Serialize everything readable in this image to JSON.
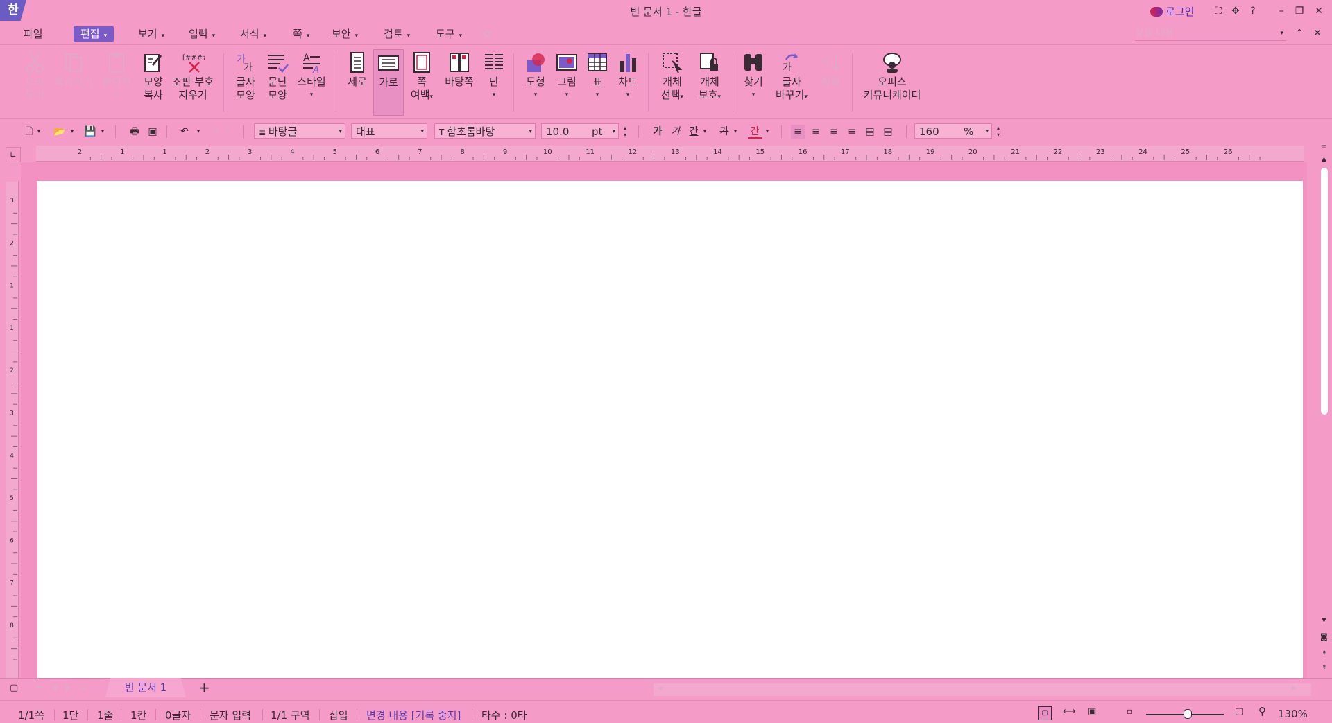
{
  "app": {
    "logo": "한",
    "title": "빈 문서 1 - 한글",
    "login": "로그인"
  },
  "window_controls": {
    "fullscreen": "⛶",
    "move": "✥",
    "help": "?",
    "minimize": "–",
    "restore": "❐",
    "close": "✕"
  },
  "menubar": {
    "items": [
      {
        "label": "파일"
      },
      {
        "label": "편집",
        "active": true
      },
      {
        "label": "보기"
      },
      {
        "label": "입력"
      },
      {
        "label": "서식"
      },
      {
        "label": "쪽"
      },
      {
        "label": "보안"
      },
      {
        "label": "검토"
      },
      {
        "label": "도구"
      }
    ],
    "search_placeholder": "찾을 내용"
  },
  "ribbon": {
    "cut": {
      "line1": "오려",
      "line2": "두기"
    },
    "copy": {
      "label": "복사하기"
    },
    "paste": {
      "label": "붙이기"
    },
    "format_copy": {
      "line1": "모양",
      "line2": "복사"
    },
    "clear_marks": {
      "line1": "조판 부호",
      "line2": "지우기"
    },
    "char_shape": {
      "line1": "글자",
      "line2": "모양"
    },
    "para_shape": {
      "line1": "문단",
      "line2": "모양"
    },
    "style": {
      "label": "스타일"
    },
    "portrait": {
      "label": "세로"
    },
    "landscape": {
      "label": "가로"
    },
    "margins": {
      "line1": "쪽",
      "line2": "여백"
    },
    "master_page": {
      "label": "바탕쪽"
    },
    "columns": {
      "label": "단"
    },
    "shape": {
      "label": "도형"
    },
    "picture": {
      "label": "그림"
    },
    "table": {
      "label": "표"
    },
    "chart": {
      "label": "차트"
    },
    "object_select": {
      "line1": "개체",
      "line2": "선택"
    },
    "object_protect": {
      "line1": "개체",
      "line2": "보호"
    },
    "find": {
      "label": "찾기"
    },
    "replace": {
      "line1": "글자",
      "line2": "바꾸기"
    },
    "sort": {
      "label": "정렬"
    },
    "office_communicator": {
      "line1": "오피스",
      "line2": "커뮤니케이터"
    }
  },
  "format_toolbar": {
    "style_value": "바탕글",
    "language_value": "대표",
    "font_value": "함초롬바탕",
    "font_size": "10.0",
    "size_unit": "pt",
    "bold": "가",
    "italic": "가",
    "underline": "간",
    "strike": "가",
    "color": "간",
    "zoom_value": "160",
    "zoom_unit": "%"
  },
  "ruler": {
    "h_ticks": [
      "2",
      "1",
      "1",
      "2",
      "3",
      "4",
      "5",
      "6",
      "7",
      "8",
      "9",
      "10",
      "11",
      "12",
      "13",
      "14",
      "15",
      "16",
      "17",
      "18",
      "19",
      "20",
      "21",
      "22",
      "23",
      "24",
      "25",
      "26"
    ],
    "v_ticks": [
      "3",
      "2",
      "1",
      "1",
      "2",
      "3",
      "4",
      "5",
      "6",
      "7",
      "8"
    ]
  },
  "tabs": {
    "document": "빈 문서 1",
    "add": "+"
  },
  "statusbar": {
    "page": "1/1쪽",
    "column": "1단",
    "line": "1줄",
    "char_col": "1칸",
    "chars": "0글자",
    "input_mode": "문자 입력",
    "section": "1/1 구역",
    "insert": "삽입",
    "track_changes": "변경 내용 [기록 중지]",
    "keystrokes": "타수 : 0타",
    "zoom": "130%"
  }
}
